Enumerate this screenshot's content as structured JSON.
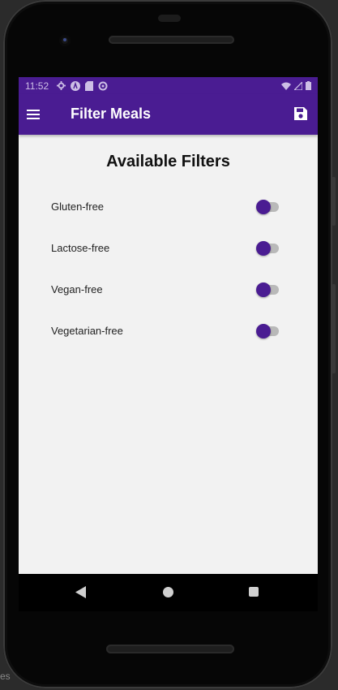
{
  "status_bar": {
    "time": "11:52"
  },
  "app_bar": {
    "title": "Filter Meals",
    "menu_icon": "hamburger-menu-icon",
    "save_icon": "floppy-disk-icon"
  },
  "content": {
    "heading": "Available Filters",
    "filters": [
      {
        "label": "Gluten-free",
        "enabled": true
      },
      {
        "label": "Lactose-free",
        "enabled": true
      },
      {
        "label": "Vegan-free",
        "enabled": true
      },
      {
        "label": "Vegetarian-free",
        "enabled": true
      }
    ]
  },
  "background": {
    "partial_text": "es"
  },
  "colors": {
    "primary": "#4a1c92",
    "screen_bg": "#f2f2f2",
    "switch_track": "#b9b9b9"
  }
}
